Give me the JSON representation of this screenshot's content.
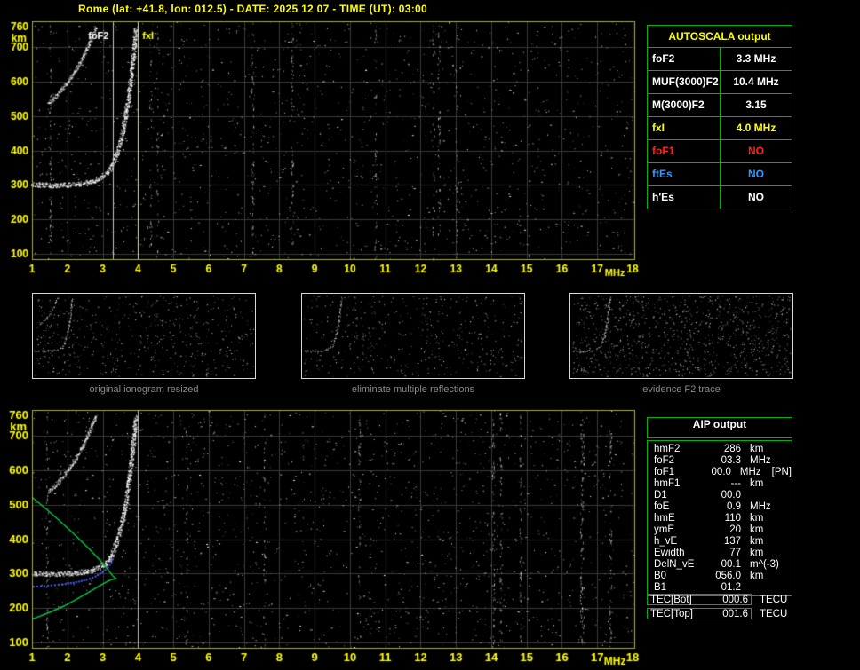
{
  "title": "Rome (lat: +41.8, lon: 012.5) - DATE: 2025 12 07 - TIME (UT): 03:00",
  "autoscala": {
    "header": "AUTOSCALA output",
    "rows": [
      {
        "label": "foF2",
        "value": "3.3 MHz",
        "color": "#ffffff"
      },
      {
        "label": "MUF(3000)F2",
        "value": "10.4 MHz",
        "color": "#ffffff"
      },
      {
        "label": "M(3000)F2",
        "value": "3.15",
        "color": "#ffffff"
      },
      {
        "label": "fxI",
        "value": "4.0 MHz",
        "color": "#ffff00"
      },
      {
        "label": "foF1",
        "value": "NO",
        "color": "#ff2020"
      },
      {
        "label": "ftEs",
        "value": "NO",
        "color": "#3399ff"
      },
      {
        "label": "h'Es",
        "value": "NO",
        "color": "#ffffff"
      }
    ]
  },
  "aip": {
    "header": "AIP output",
    "rows": [
      {
        "label": "hmF2",
        "value": "286",
        "unit": "km",
        "extra": ""
      },
      {
        "label": "foF2",
        "value": "03.3",
        "unit": "MHz",
        "extra": ""
      },
      {
        "label": "foF1",
        "value": "00.0",
        "unit": "MHz",
        "extra": "[PN]"
      },
      {
        "label": "hmF1",
        "value": "---",
        "unit": "km",
        "extra": ""
      },
      {
        "label": "D1",
        "value": "00.0",
        "unit": "",
        "extra": ""
      },
      {
        "label": "foE",
        "value": "0.9",
        "unit": "MHz",
        "extra": ""
      },
      {
        "label": "hmE",
        "value": "110",
        "unit": "km",
        "extra": ""
      },
      {
        "label": "ymE",
        "value": "20",
        "unit": "km",
        "extra": ""
      },
      {
        "label": "h_vE",
        "value": "137",
        "unit": "km",
        "extra": ""
      },
      {
        "label": "Ewidth",
        "value": "77",
        "unit": "km",
        "extra": ""
      },
      {
        "label": "DelN_vE",
        "value": "00.1",
        "unit": "m^(-3)",
        "extra": ""
      },
      {
        "label": "B0",
        "value": "056.0",
        "unit": "km",
        "extra": ""
      },
      {
        "label": "B1",
        "value": "01.2",
        "unit": "",
        "extra": ""
      }
    ],
    "tec_rows": [
      {
        "label": "TEC[Bot]",
        "value": "000.6",
        "unit": "TECU"
      },
      {
        "label": "TEC[Top]",
        "value": "001.6",
        "unit": "TECU"
      }
    ]
  },
  "thumbnails": [
    {
      "caption": "original ionogram resized",
      "series_refs": [
        0,
        1
      ],
      "noise": 520
    },
    {
      "caption": "eliminate multiple reflections",
      "series_refs": [
        0
      ],
      "noise": 430
    },
    {
      "caption": "evidence F2 trace",
      "series_refs": [
        0
      ],
      "noise": 980
    }
  ],
  "chart_data": [
    {
      "type": "scatter",
      "title": "ionogram with autoscaled characteristics",
      "xlabel": "MHz",
      "ylabel": "km",
      "xlim": [
        1,
        18.05
      ],
      "ylim": [
        85,
        775
      ],
      "x_ticks": [
        1,
        2,
        3,
        4,
        5,
        6,
        7,
        8,
        9,
        10,
        11,
        12,
        13,
        14,
        15,
        16,
        17,
        18
      ],
      "y_ticks": [
        100,
        200,
        300,
        400,
        500,
        600,
        700,
        760
      ],
      "tick_color": "#ffff00",
      "grid": true,
      "annotations": [
        {
          "type": "vline",
          "x": 3.3,
          "line_color": "#c8c8c8",
          "label": "foF2",
          "label_color": "#ffffff",
          "side": "left"
        },
        {
          "type": "vline",
          "x": 4.0,
          "line_color": "#e8e880",
          "label": "fxI",
          "label_color": "#ffff00",
          "side": "right"
        }
      ],
      "series": [
        {
          "name": "F2-echo-trace",
          "style": "echo",
          "color": "#ffffff",
          "width": 3,
          "bright": 1,
          "points": [
            [
              1.0,
              302
            ],
            [
              1.3,
              301
            ],
            [
              1.6,
              300
            ],
            [
              1.9,
              301
            ],
            [
              2.2,
              303
            ],
            [
              2.5,
              307
            ],
            [
              2.75,
              313
            ],
            [
              2.95,
              322
            ],
            [
              3.1,
              334
            ],
            [
              3.22,
              350
            ],
            [
              3.32,
              372
            ],
            [
              3.42,
              402
            ],
            [
              3.52,
              440
            ],
            [
              3.62,
              490
            ],
            [
              3.72,
              552
            ],
            [
              3.8,
              620
            ],
            [
              3.87,
              690
            ],
            [
              3.93,
              758
            ]
          ]
        },
        {
          "name": "second-reflection-trace",
          "style": "echo",
          "color": "#ffffff",
          "width": 2,
          "bright": 0.7,
          "points": [
            [
              1.45,
              538
            ],
            [
              1.65,
              556
            ],
            [
              1.85,
              580
            ],
            [
              2.05,
              606
            ],
            [
              2.25,
              638
            ],
            [
              2.45,
              676
            ],
            [
              2.6,
              710
            ],
            [
              2.72,
              740
            ],
            [
              2.82,
              762
            ]
          ]
        }
      ]
    },
    {
      "type": "scatter",
      "title": "ionogram with restored trace and electron density profile",
      "xlabel": "MHz",
      "ylabel": "km",
      "xlim": [
        1,
        18.05
      ],
      "ylim": [
        85,
        775
      ],
      "x_ticks": [
        1,
        2,
        3,
        4,
        5,
        6,
        7,
        8,
        9,
        10,
        11,
        12,
        13,
        14,
        15,
        16,
        17,
        18
      ],
      "y_ticks": [
        100,
        200,
        300,
        400,
        500,
        600,
        700,
        760
      ],
      "tick_color": "#ffff00",
      "grid": true,
      "annotations": [
        {
          "type": "vline",
          "x": 4.0,
          "line_color": "#c0c0c0"
        }
      ],
      "series": [
        {
          "name": "F2-echo-trace",
          "style": "echo",
          "color": "#ffffff",
          "width": 3,
          "bright": 1,
          "points": [
            [
              1.0,
              302
            ],
            [
              1.3,
              301
            ],
            [
              1.6,
              300
            ],
            [
              1.9,
              301
            ],
            [
              2.2,
              303
            ],
            [
              2.5,
              307
            ],
            [
              2.75,
              313
            ],
            [
              2.95,
              322
            ],
            [
              3.1,
              334
            ],
            [
              3.22,
              350
            ],
            [
              3.32,
              372
            ],
            [
              3.42,
              402
            ],
            [
              3.52,
              440
            ],
            [
              3.62,
              490
            ],
            [
              3.72,
              552
            ],
            [
              3.8,
              620
            ],
            [
              3.87,
              690
            ],
            [
              3.93,
              758
            ]
          ]
        },
        {
          "name": "second-reflection-trace",
          "style": "echo",
          "color": "#ffffff",
          "width": 2,
          "bright": 0.7,
          "points": [
            [
              1.45,
              538
            ],
            [
              1.65,
              556
            ],
            [
              1.85,
              580
            ],
            [
              2.05,
              606
            ],
            [
              2.25,
              638
            ],
            [
              2.45,
              676
            ],
            [
              2.6,
              710
            ],
            [
              2.72,
              740
            ],
            [
              2.82,
              762
            ]
          ]
        },
        {
          "name": "profile-topside",
          "style": "line",
          "color": "#00cc44",
          "points": [
            [
              1.0,
              522
            ],
            [
              1.4,
              488
            ],
            [
              1.8,
              452
            ],
            [
              2.2,
              414
            ],
            [
              2.6,
              374
            ],
            [
              2.9,
              342
            ],
            [
              3.15,
              312
            ],
            [
              3.3,
              292
            ],
            [
              3.38,
              286
            ]
          ]
        },
        {
          "name": "profile-bottomside",
          "style": "line",
          "color": "#00cc44",
          "points": [
            [
              1.0,
              168
            ],
            [
              1.2,
              176
            ],
            [
              1.5,
              188
            ],
            [
              1.9,
              206
            ],
            [
              2.3,
              228
            ],
            [
              2.7,
              252
            ],
            [
              3.0,
              270
            ],
            [
              3.2,
              281
            ],
            [
              3.38,
              286
            ]
          ]
        },
        {
          "name": "autoscaled-trace",
          "style": "dots",
          "color": "#4d5dff",
          "points": [
            [
              1.05,
              262
            ],
            [
              1.35,
              264
            ],
            [
              1.65,
              267
            ],
            [
              1.95,
              270
            ],
            [
              2.25,
              275
            ],
            [
              2.55,
              282
            ],
            [
              2.8,
              292
            ],
            [
              3.0,
              304
            ],
            [
              3.15,
              318
            ],
            [
              3.25,
              333
            ],
            [
              3.32,
              350
            ]
          ]
        }
      ]
    }
  ]
}
